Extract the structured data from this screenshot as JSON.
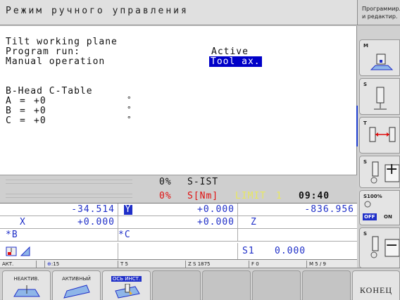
{
  "header": {
    "title": "Режим ручного управления",
    "side_line1": "Программир.",
    "side_line2": "и редактир."
  },
  "main": {
    "line1": "Tilt working plane",
    "program_run_label": "Program run:",
    "program_run_value": "Active",
    "manual_label": "Manual operation",
    "manual_value": "Tool ax.",
    "head_table": "B-Head C-Table",
    "axes": [
      {
        "name": "A",
        "eq": "=",
        "value": "+0",
        "unit": "°"
      },
      {
        "name": "B",
        "eq": "=",
        "value": "+0",
        "unit": "°"
      },
      {
        "name": "C",
        "eq": "=",
        "value": "+0",
        "unit": "°"
      }
    ]
  },
  "status": {
    "s_ist_pct": "0%",
    "s_ist_label": "S-IST",
    "snm_pct": "0%",
    "snm_label": "S[Nm]",
    "limit_label": "LIMIT",
    "limit_value": "1",
    "clock": "09:40"
  },
  "positions": {
    "x_label": "X",
    "x_value": "-34.514",
    "y_label": "Y",
    "y_value": "+0.000",
    "z_label": "Z",
    "z_value": "-836.956",
    "b_label": "*B",
    "b_value": "+0.000",
    "c_label": "*C",
    "c_value": "+0.000",
    "s1_label": "S1",
    "s1_value": "0.000"
  },
  "small_status": {
    "mode": "АКТ.",
    "tool_count": "15",
    "t": "T 5",
    "z_s": "Z S 1875",
    "f": "F 0",
    "m": "M 5 / 9"
  },
  "right_softkeys": [
    {
      "tag": "M",
      "icon": "machine-mode-icon"
    },
    {
      "tag": "S",
      "icon": "spindle-icon"
    },
    {
      "tag": "T",
      "icon": "tool-change-icon"
    },
    {
      "tag": "S",
      "icon": "spindle-plus-icon",
      "symbol": "+"
    },
    {
      "tag": "S100%",
      "icon": "spindle-override-icon",
      "toggle_off": "OFF",
      "toggle_on": "ON"
    },
    {
      "tag": "S",
      "icon": "spindle-minus-icon",
      "symbol": "−"
    }
  ],
  "bottom_softkeys": [
    {
      "label": "НЕАКТИВ."
    },
    {
      "label": "АКТИВНЫЙ"
    },
    {
      "label": "ОСЬ ИНСТ."
    },
    {
      "label": ""
    },
    {
      "label": ""
    },
    {
      "label": ""
    },
    {
      "label": ""
    },
    {
      "label": "КОНЕЦ"
    }
  ],
  "colors": {
    "accent_blue": "#1f2fc8",
    "highlight_blue": "#0000c8",
    "red": "#e01010",
    "yellow": "#e8e860"
  }
}
